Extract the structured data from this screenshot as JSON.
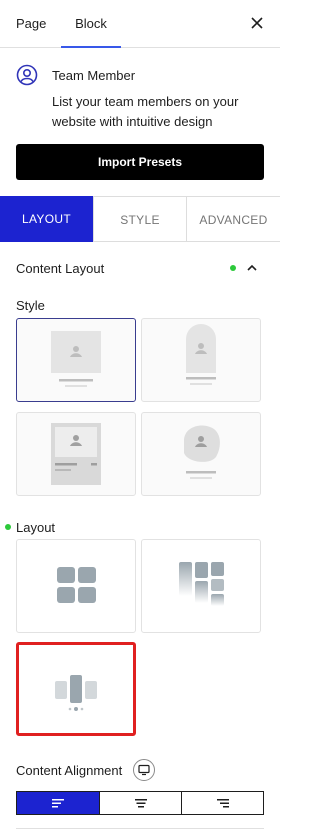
{
  "top_tabs": {
    "page": "Page",
    "block": "Block"
  },
  "block_card": {
    "title": "Team Member",
    "description": "List your team members on your website with intuitive design",
    "icon": "user-circle-icon"
  },
  "import_button": "Import Presets",
  "section_tabs": {
    "layout": "LAYOUT",
    "style": "STYLE",
    "advanced": "ADVANCED",
    "active": "layout"
  },
  "panel": {
    "title": "Content Layout",
    "expanded": true
  },
  "style_section": {
    "label": "Style",
    "options": [
      {
        "name": "style-1",
        "selected": true
      },
      {
        "name": "style-2",
        "selected": false
      },
      {
        "name": "style-3",
        "selected": false
      },
      {
        "name": "style-4",
        "selected": false
      }
    ]
  },
  "layout_section": {
    "label": "Layout",
    "options": [
      {
        "name": "grid",
        "selected": false
      },
      {
        "name": "masonry",
        "selected": false
      },
      {
        "name": "carousel",
        "selected": false,
        "highlighted": true
      }
    ]
  },
  "content_alignment": {
    "label": "Content Alignment",
    "options": [
      "left",
      "center",
      "right"
    ],
    "selected": "left"
  },
  "colors": {
    "accent_blue": "#1c23d0",
    "tab_underline": "#3858e9",
    "status_green": "#2cc93a",
    "highlight_red": "#e02020"
  }
}
